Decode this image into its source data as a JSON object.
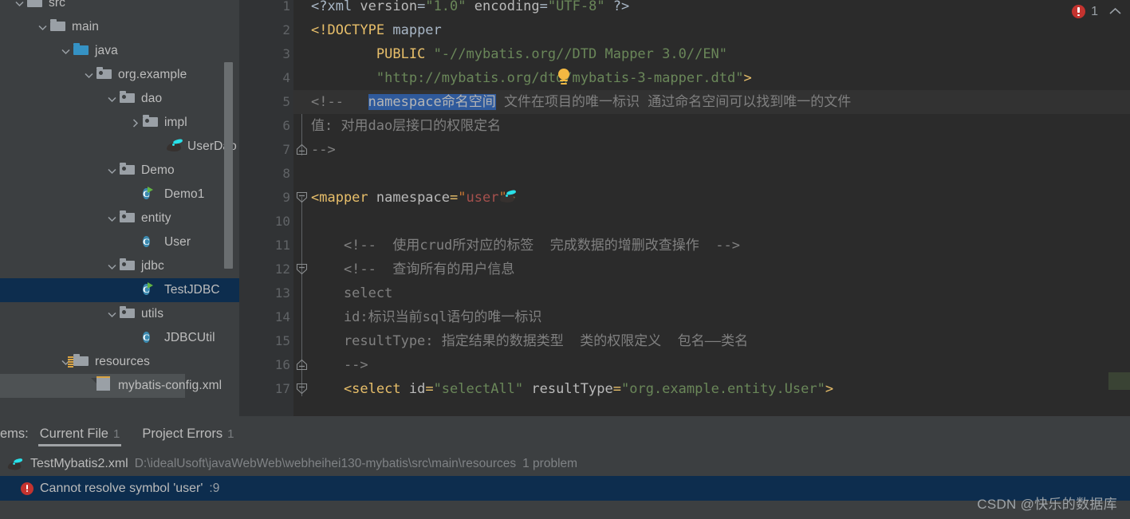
{
  "sidebar": {
    "scrollbar": true,
    "tree": [
      {
        "label": "src",
        "indent": 0,
        "arrow": "down",
        "icon": "folder",
        "state": "normal"
      },
      {
        "label": "main",
        "indent": 1,
        "arrow": "down",
        "icon": "folder",
        "state": "normal"
      },
      {
        "label": "java",
        "indent": 2,
        "arrow": "down",
        "icon": "folder-blue",
        "state": "normal"
      },
      {
        "label": "org.example",
        "indent": 3,
        "arrow": "down",
        "icon": "folder-package",
        "state": "normal"
      },
      {
        "label": "dao",
        "indent": 4,
        "arrow": "down",
        "icon": "folder-package",
        "state": "normal"
      },
      {
        "label": "impl",
        "indent": 5,
        "arrow": "right",
        "icon": "folder-package",
        "state": "normal"
      },
      {
        "label": "UserDao",
        "indent": 6,
        "arrow": "none",
        "icon": "mybatis-bird",
        "state": "normal"
      },
      {
        "label": "Demo",
        "indent": 4,
        "arrow": "down",
        "icon": "folder-package",
        "state": "normal"
      },
      {
        "label": "Demo1",
        "indent": 5,
        "arrow": "none",
        "icon": "java-class-run",
        "state": "normal"
      },
      {
        "label": "entity",
        "indent": 4,
        "arrow": "down",
        "icon": "folder-package",
        "state": "normal"
      },
      {
        "label": "User",
        "indent": 5,
        "arrow": "none",
        "icon": "java-class",
        "state": "normal"
      },
      {
        "label": "jdbc",
        "indent": 4,
        "arrow": "down",
        "icon": "folder-package",
        "state": "normal"
      },
      {
        "label": "TestJDBC",
        "indent": 5,
        "arrow": "none",
        "icon": "java-class-run",
        "state": "selected"
      },
      {
        "label": "utils",
        "indent": 4,
        "arrow": "down",
        "icon": "folder-package",
        "state": "normal"
      },
      {
        "label": "JDBCUtil",
        "indent": 5,
        "arrow": "none",
        "icon": "java-class",
        "state": "normal"
      },
      {
        "label": "resources",
        "indent": 2,
        "arrow": "down",
        "icon": "folder-resources",
        "state": "normal"
      },
      {
        "label": "mybatis-config.xml",
        "indent": 3,
        "arrow": "none",
        "icon": "xml-file",
        "state": "hovered"
      }
    ]
  },
  "editor": {
    "file_type": "xml",
    "bulb_line": 4,
    "gutter_bird_line": 9,
    "lines": [
      {
        "n": 1,
        "tokens": [
          {
            "t": "<?xml ",
            "c": "plain"
          },
          {
            "t": "version",
            "c": "attr"
          },
          {
            "t": "=",
            "c": "plain"
          },
          {
            "t": "\"1.0\"",
            "c": "str"
          },
          {
            "t": " ",
            "c": "plain"
          },
          {
            "t": "encoding",
            "c": "attr"
          },
          {
            "t": "=",
            "c": "plain"
          },
          {
            "t": "\"UTF-8\"",
            "c": "str"
          },
          {
            "t": " ?>",
            "c": "plain"
          }
        ]
      },
      {
        "n": 2,
        "tokens": [
          {
            "t": "<!DOCTYPE",
            "c": "kw"
          },
          {
            "t": " mapper",
            "c": "plain"
          }
        ]
      },
      {
        "n": 3,
        "tokens": [
          {
            "t": "        ",
            "c": "plain"
          },
          {
            "t": "PUBLIC",
            "c": "kw"
          },
          {
            "t": " ",
            "c": "plain"
          },
          {
            "t": "\"-//mybatis.org//DTD Mapper 3.0//EN\"",
            "c": "str"
          }
        ]
      },
      {
        "n": 4,
        "tokens": [
          {
            "t": "        ",
            "c": "plain"
          },
          {
            "t": "\"http://mybatis.org/dtd/mybatis-3-mapper.dtd\"",
            "c": "str"
          },
          {
            "t": ">",
            "c": "kw"
          }
        ]
      },
      {
        "n": 5,
        "tokens": [
          {
            "t": "<!--   ",
            "c": "cmt"
          },
          {
            "t": "namespace命名空间",
            "c": "sel"
          },
          {
            "t": " 文件在项目的唯一标识 通过命名空间可以找到唯一的文件",
            "c": "cmt"
          }
        ],
        "caret": true
      },
      {
        "n": 6,
        "tokens": [
          {
            "t": "值: 对用dao层接口的权限定名",
            "c": "cmt"
          }
        ]
      },
      {
        "n": 7,
        "tokens": [
          {
            "t": "-->",
            "c": "cmt"
          }
        ]
      },
      {
        "n": 8,
        "tokens": []
      },
      {
        "n": 9,
        "tokens": [
          {
            "t": "<mapper",
            "c": "tag"
          },
          {
            "t": " namespace",
            "c": "attr"
          },
          {
            "t": "=",
            "c": "tag"
          },
          {
            "t": "\"",
            "c": "strred"
          },
          {
            "t": "user",
            "c": "strval"
          },
          {
            "t": "\"",
            "c": "strred"
          },
          {
            "t": ">",
            "c": "tag"
          }
        ]
      },
      {
        "n": 10,
        "tokens": []
      },
      {
        "n": 11,
        "tokens": [
          {
            "t": "    <!--  使用crud所对应的标签  完成数据的增删改查操作  -->",
            "c": "cmt"
          }
        ]
      },
      {
        "n": 12,
        "tokens": [
          {
            "t": "    <!--  查询所有的用户信息",
            "c": "cmt"
          }
        ]
      },
      {
        "n": 13,
        "tokens": [
          {
            "t": "    select",
            "c": "cmt"
          }
        ]
      },
      {
        "n": 14,
        "tokens": [
          {
            "t": "    id:标识当前sql语句的唯一标识",
            "c": "cmt"
          }
        ]
      },
      {
        "n": 15,
        "tokens": [
          {
            "t": "    resultType: 指定结果的数据类型  类的权限定义  包名——类名",
            "c": "cmt"
          }
        ]
      },
      {
        "n": 16,
        "tokens": [
          {
            "t": "    -->",
            "c": "cmt"
          }
        ]
      },
      {
        "n": 17,
        "tokens": [
          {
            "t": "    <select",
            "c": "tag"
          },
          {
            "t": " id",
            "c": "attr"
          },
          {
            "t": "=",
            "c": "tag"
          },
          {
            "t": "\"selectAll\"",
            "c": "str"
          },
          {
            "t": " resultType",
            "c": "attr"
          },
          {
            "t": "=",
            "c": "tag"
          },
          {
            "t": "\"org.example.entity.User\"",
            "c": "str"
          },
          {
            "t": ">",
            "c": "tag"
          }
        ],
        "clipped": true
      }
    ],
    "error_indicator": {
      "icon": "error-circle-icon",
      "count": "1",
      "collapse_icon": "chevron-up-icon"
    }
  },
  "problems_panel": {
    "label": "ems:",
    "tabs": [
      {
        "name": "current-file",
        "label": "Current File",
        "count": "1",
        "active": true
      },
      {
        "name": "project-errors",
        "label": "Project Errors",
        "count": "1",
        "active": false
      }
    ],
    "file_row": {
      "icon": "mybatis-file-icon",
      "name": "TestMybatis2.xml",
      "path": "D:\\idealUsoft\\javaWebWeb\\webheihei130-mybatis\\src\\main\\resources",
      "count": "1 problem"
    },
    "problem_row": {
      "icon": "error-circle-icon",
      "message": "Cannot resolve symbol 'user'",
      "location": ":9"
    }
  },
  "watermark": {
    "text": "CSDN @快乐的数据库"
  },
  "colors": {
    "editor_bg": "#2b2b2b",
    "gutter_bg": "#313335",
    "sidebar_bg": "#3c3f41",
    "selection_blue": "#0d2d4e",
    "text_selection": "#2f5a9c",
    "error_red": "#c4332f",
    "comment_grey": "#808080",
    "string_green": "#6a8759",
    "tag_yellow": "#e8bf6a",
    "caret_line": "#323232",
    "green_stripe": "#3a4334"
  }
}
